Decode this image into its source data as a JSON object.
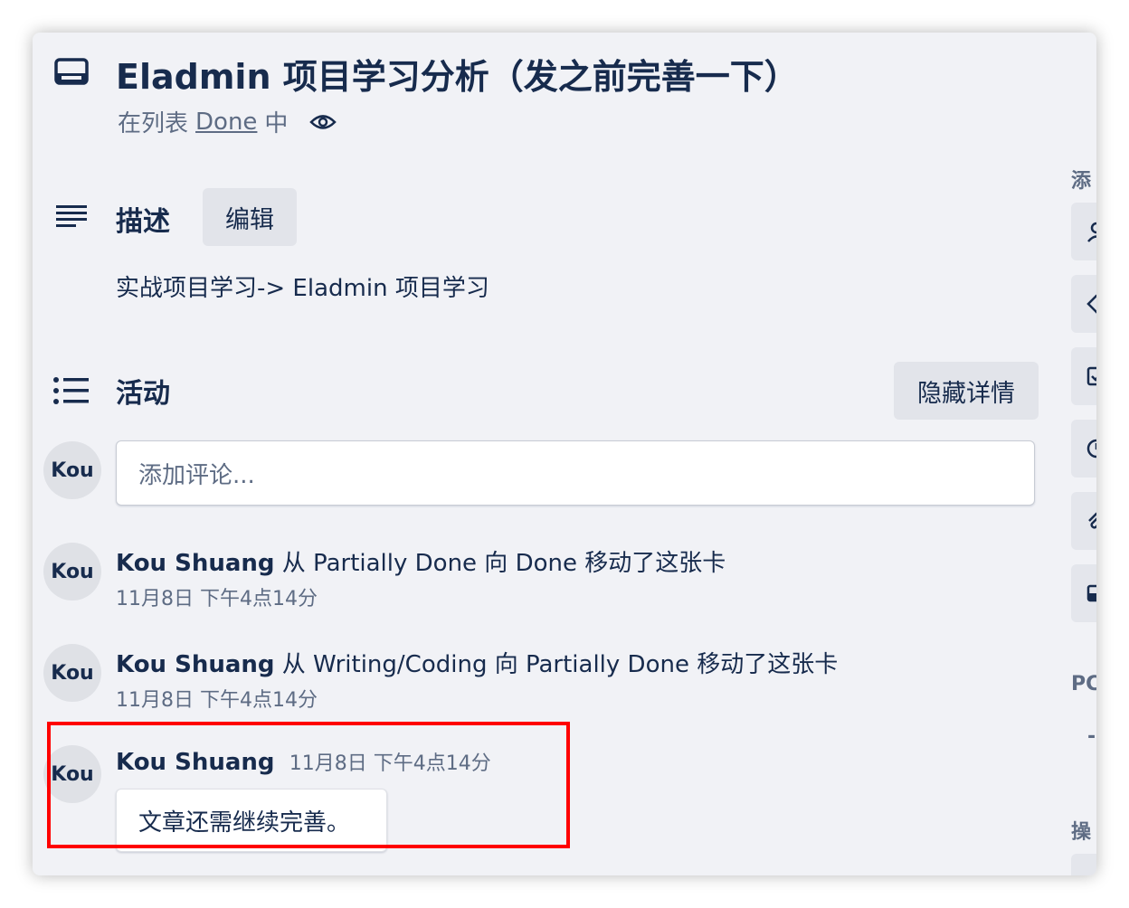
{
  "card": {
    "title": "Eladmin 项目学习分析（发之前完善一下）",
    "list_prefix": "在列表",
    "list_name": "Done",
    "list_suffix": "中"
  },
  "description": {
    "heading": "描述",
    "edit_label": "编辑",
    "text": "实战项目学习-> Eladmin 项目学习"
  },
  "activity": {
    "heading": "活动",
    "hide_details_label": "隐藏详情",
    "comment_placeholder": "添加评论...",
    "current_user_avatar": "Kou",
    "items": [
      {
        "avatar": "Kou",
        "user": "Kou Shuang",
        "text": "从 Partially Done 向 Done 移动了这张卡",
        "time": "11月8日 下午4点14分"
      },
      {
        "avatar": "Kou",
        "user": "Kou Shuang",
        "text": "从 Writing/Coding 向 Partially Done 移动了这张卡",
        "time": "11月8日 下午4点14分"
      }
    ],
    "comment": {
      "avatar": "Kou",
      "user": "Kou Shuang",
      "time": "11月8日 下午4点14分",
      "text": "文章还需继续完善。"
    }
  },
  "sidebar": {
    "add_label": "添",
    "power_label": "PC",
    "dash": "-",
    "actions_label": "操",
    "icons": [
      "user-icon",
      "label-icon",
      "checklist-icon",
      "clock-icon",
      "attachment-icon",
      "cover-icon"
    ]
  },
  "colors": {
    "highlight_border": "#ff0000",
    "text_primary": "#172b4d",
    "text_secondary": "#5e6c84",
    "panel_background": "#f1f2f6"
  }
}
